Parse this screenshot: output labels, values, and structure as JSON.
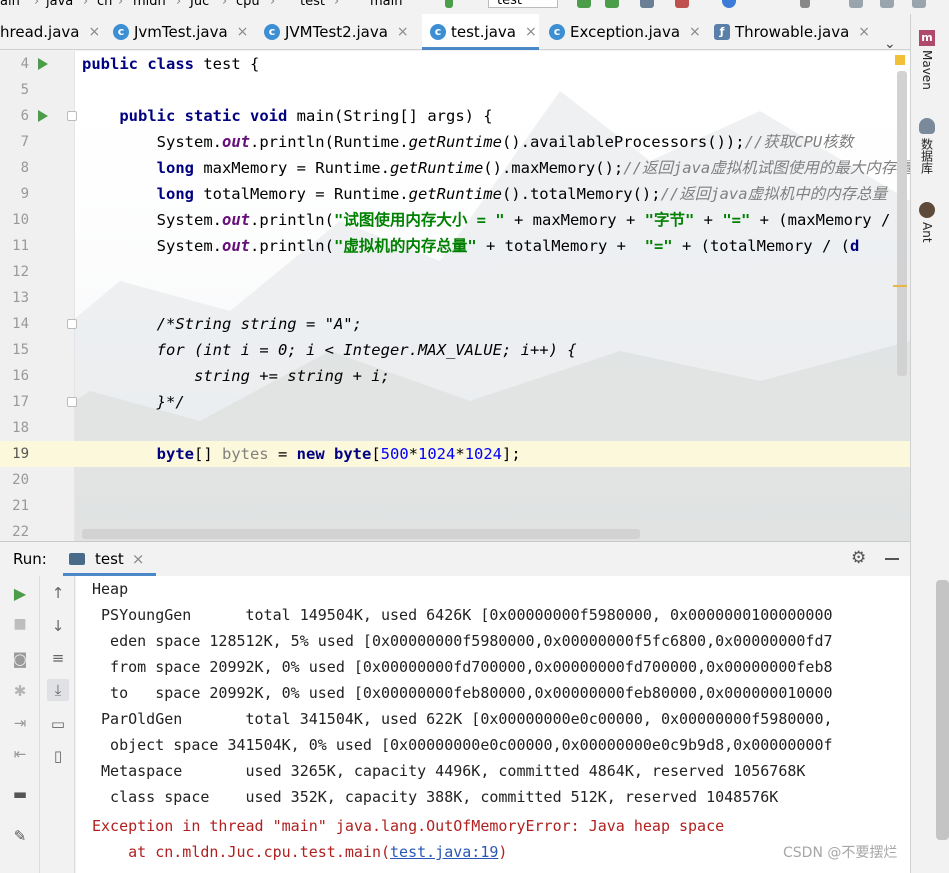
{
  "breadcrumbs": [
    "ain",
    "java",
    "cn",
    "mldn",
    "Juc",
    "cpu",
    "test",
    "main"
  ],
  "run_config": "test",
  "tabs": [
    {
      "label": "hread.java",
      "icon": "java-class-icon",
      "active": false
    },
    {
      "label": "JvmTest.java",
      "icon": "java-class-icon",
      "active": false
    },
    {
      "label": "JVMTest2.java",
      "icon": "java-class-icon",
      "active": false
    },
    {
      "label": "test.java",
      "icon": "java-class-icon",
      "active": true
    },
    {
      "label": "Exception.java",
      "icon": "java-class-icon",
      "active": false
    },
    {
      "label": "Throwable.java",
      "icon": "java-class-icon",
      "active": false
    }
  ],
  "right_panels": [
    "Maven",
    "数据库",
    "Ant"
  ],
  "editor": {
    "lines": [
      {
        "num": "4"
      },
      {
        "num": "5"
      },
      {
        "num": "6"
      },
      {
        "num": "7"
      },
      {
        "num": "8"
      },
      {
        "num": "9"
      },
      {
        "num": "10"
      },
      {
        "num": "11"
      },
      {
        "num": "12"
      },
      {
        "num": "13"
      },
      {
        "num": "14"
      },
      {
        "num": "15"
      },
      {
        "num": "16"
      },
      {
        "num": "17"
      },
      {
        "num": "18"
      },
      {
        "num": "19"
      },
      {
        "num": "20"
      },
      {
        "num": "21"
      },
      {
        "num": "22"
      }
    ],
    "code": {
      "l4_kw1": "public",
      "l4_kw2": "class",
      "l4_rest": " test {",
      "l6_kw1": "public",
      "l6_kw2": "static",
      "l6_kw3": "void",
      "l6_rest": " main(String[] args) {",
      "l7_a": "System.",
      "l7_out": "out",
      "l7_b": ".println(Runtime.",
      "l7_m": "getRuntime",
      "l7_c": "().availableProcessors());",
      "l7_cm": "//获取CPU核数",
      "l8_kw": "long",
      "l8_a": " maxMemory = Runtime.",
      "l8_m": "getRuntime",
      "l8_b": "().maxMemory();",
      "l8_cm": "//返回java虚拟机试图使用的最大内存量",
      "l9_kw": "long",
      "l9_a": " totalMemory = Runtime.",
      "l9_m": "getRuntime",
      "l9_b": "().totalMemory();",
      "l9_cm": "//返回java虚拟机中的内存总量",
      "l10_a": "System.",
      "l10_out": "out",
      "l10_b": ".println(",
      "l10_s1": "\"试图使用内存大小 = \"",
      "l10_c": " + maxMemory + ",
      "l10_s2": "\"字节\"",
      "l10_d": " + ",
      "l10_s3": "\"=\"",
      "l10_e": " + (maxMemory / (",
      "l11_a": "System.",
      "l11_out": "out",
      "l11_b": ".println(",
      "l11_s1": "\"虚拟机的内存总量\"",
      "l11_c": " + totalMemory +  ",
      "l11_s2": "\"=\"",
      "l11_d": " + (totalMemory / (",
      "l11_e": "d",
      "l14": "/*String string = \"A\";",
      "l15_kw": "for",
      "l15_a": " (",
      "l15_kw2": "int",
      "l15_b": " i = 0; i < Integer.MAX_VALUE; i++) {",
      "l16": "string += string + i;",
      "l17": "}*/",
      "l19_kw": "byte",
      "l19_a": "[] ",
      "l19_var": "bytes",
      "l19_b": " = ",
      "l19_kw2": "new",
      "l19_c": " ",
      "l19_kw3": "byte",
      "l19_d": "[",
      "l19_n1": "500",
      "l19_e": "*",
      "l19_n2": "1024",
      "l19_f": "*",
      "l19_n3": "1024",
      "l19_g": "];"
    }
  },
  "run_panel": {
    "title": "Run:",
    "tab_label": "test",
    "console": [
      "Heap",
      " PSYoungGen      total 149504K, used 6426K [0x00000000f5980000, 0x0000000100000000",
      "  eden space 128512K, 5% used [0x00000000f5980000,0x00000000f5fc6800,0x00000000fd7",
      "  from space 20992K, 0% used [0x00000000fd700000,0x00000000fd700000,0x00000000feb8",
      "  to   space 20992K, 0% used [0x00000000feb80000,0x00000000feb80000,0x000000010000",
      " ParOldGen       total 341504K, used 622K [0x00000000e0c00000, 0x00000000f5980000,",
      "  object space 341504K, 0% used [0x00000000e0c00000,0x00000000e0c9b9d8,0x00000000f",
      " Metaspace       used 3265K, capacity 4496K, committed 4864K, reserved 1056768K",
      "  class space    used 352K, capacity 388K, committed 512K, reserved 1048576K"
    ],
    "error_line": "Exception in thread \"main\" java.lang.OutOfMemoryError: Java heap space",
    "at_prefix": "    at cn.mldn.Juc.cpu.test.main(",
    "at_link": "test.java:19",
    "at_suffix": ")"
  },
  "watermark_credit": "CSDN @不要摆烂",
  "colors": {
    "keyword": "#000080",
    "string": "#008000",
    "comment": "#808080",
    "number": "#0000ff",
    "static_field": "#660e7a",
    "error": "#b11f1f",
    "tab_underline": "#4a88c7",
    "current_line": "#fbf8dc"
  }
}
